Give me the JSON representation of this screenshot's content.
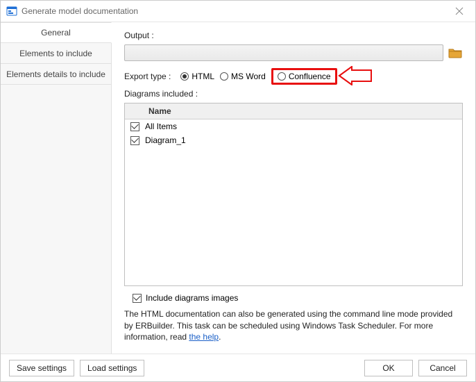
{
  "title": "Generate model documentation",
  "tabs": {
    "general": "General",
    "elements": "Elements to include",
    "details": "Elements details to include"
  },
  "output": {
    "label": "Output  :",
    "value": ""
  },
  "export": {
    "label": "Export type  :",
    "options": {
      "html": "HTML",
      "msword": "MS Word",
      "confluence": "Confluence"
    }
  },
  "diagrams": {
    "label": "Diagrams included :",
    "header": "Name",
    "items": [
      {
        "label": "All Items"
      },
      {
        "label": "Diagram_1"
      }
    ]
  },
  "include_images": "Include diagrams images",
  "help_prefix": "The HTML documentation can also be generated using the command line mode provided by ERBuilder. This task can be scheduled using Windows Task Scheduler. For more information, read ",
  "help_link": "the help",
  "help_suffix": ".",
  "buttons": {
    "save": "Save settings",
    "load": "Load settings",
    "ok": "OK",
    "cancel": "Cancel"
  }
}
